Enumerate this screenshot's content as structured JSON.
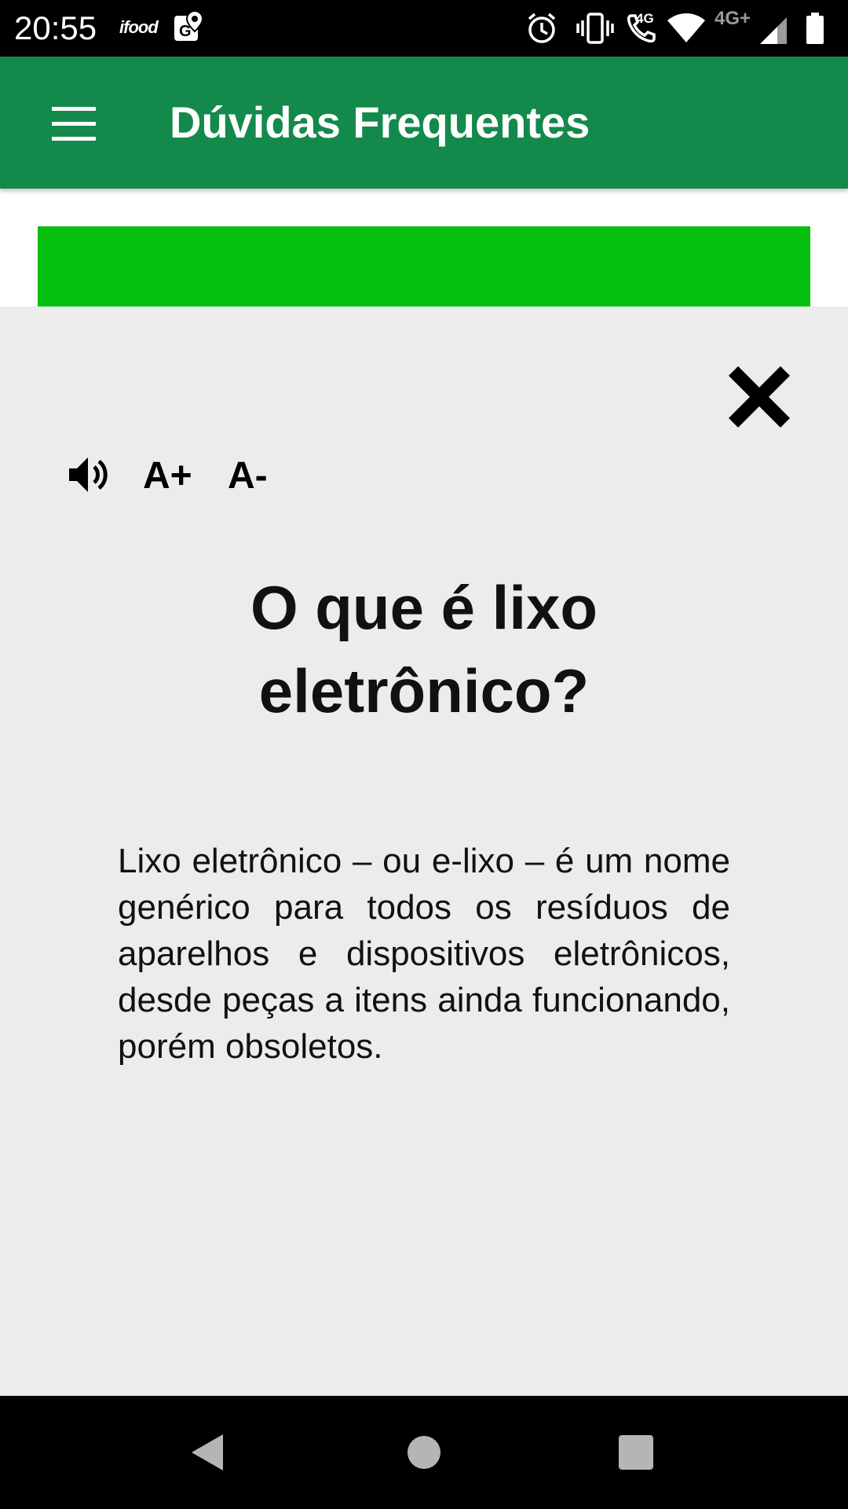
{
  "status_bar": {
    "time": "20:55",
    "notifications": [
      "ifood",
      "maps-pin"
    ],
    "app_notification_label": "ifood",
    "call_network_label": "4G",
    "mobile_network_label": "4G+",
    "icons": [
      "alarm-icon",
      "vibrate-icon",
      "wifi-call-icon",
      "wifi-icon",
      "signal-icon",
      "battery-icon"
    ]
  },
  "app_bar": {
    "title": "Dúvidas Frequentes",
    "background_color": "#13894b",
    "menu_icon": "hamburger-menu-icon"
  },
  "page_under": {
    "banner_color": "#05c00f"
  },
  "modal": {
    "close_icon": "close-icon",
    "tools": {
      "speaker_icon": "speaker-icon",
      "font_increase_label": "A+",
      "font_decrease_label": "A-"
    },
    "question": "O que é lixo eletrônico?",
    "answer": "Lixo eletrônico – ou e-lixo – é um nome genérico para todos os resíduos de aparelhos e dispositivos eletrônicos, desde peças a itens ainda funcionando, porém obsoletos."
  },
  "nav_bar": {
    "buttons": [
      "back-icon",
      "home-icon",
      "recents-icon"
    ]
  }
}
